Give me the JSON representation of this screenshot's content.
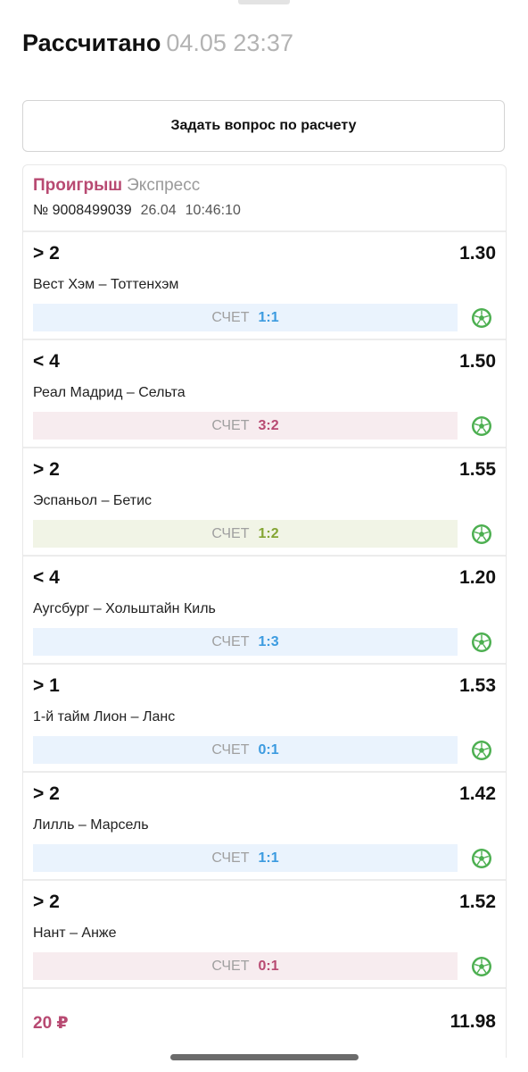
{
  "header": {
    "title": "Рассчитано",
    "datetime": "04.05 23:37"
  },
  "ask_button": {
    "label": "Задать вопрос по расчету"
  },
  "ticket": {
    "result": "Проигрыш",
    "type": "Экспресс",
    "number": "№ 9008499039",
    "date": "26.04",
    "time": "10:46:10"
  },
  "score_label": "СЧЕТ",
  "colors": {
    "loss": "#b84a72",
    "score_blue": "#3c9be0",
    "score_green": "#84a533",
    "ball_icon": "#4caf50"
  },
  "bets": [
    {
      "condition": "> 2",
      "odds": "1.30",
      "match": "Вест Хэм – Тоттенхэм",
      "score": "1:1",
      "score_style": "blue",
      "icon": "soccer-ball-icon"
    },
    {
      "condition": "< 4",
      "odds": "1.50",
      "match": "Реал Мадрид – Сельта",
      "score": "3:2",
      "score_style": "pink",
      "icon": "soccer-ball-icon"
    },
    {
      "condition": "> 2",
      "odds": "1.55",
      "match": "Эспаньол – Бетис",
      "score": "1:2",
      "score_style": "green",
      "icon": "soccer-ball-icon"
    },
    {
      "condition": "< 4",
      "odds": "1.20",
      "match": "Аугсбург – Хольштайн Киль",
      "score": "1:3",
      "score_style": "blue",
      "icon": "soccer-ball-icon"
    },
    {
      "condition": "> 1",
      "odds": "1.53",
      "match": "1-й тайм Лион – Ланс",
      "score": "0:1",
      "score_style": "blue",
      "icon": "soccer-ball-icon"
    },
    {
      "condition": "> 2",
      "odds": "1.42",
      "match": "Лилль – Марсель",
      "score": "1:1",
      "score_style": "blue",
      "icon": "soccer-ball-icon"
    },
    {
      "condition": "> 2",
      "odds": "1.52",
      "match": "Нант – Анже",
      "score": "0:1",
      "score_style": "pink",
      "icon": "soccer-ball-icon"
    }
  ],
  "footer": {
    "stake": "20 ₽",
    "total_odds": "11.98"
  }
}
